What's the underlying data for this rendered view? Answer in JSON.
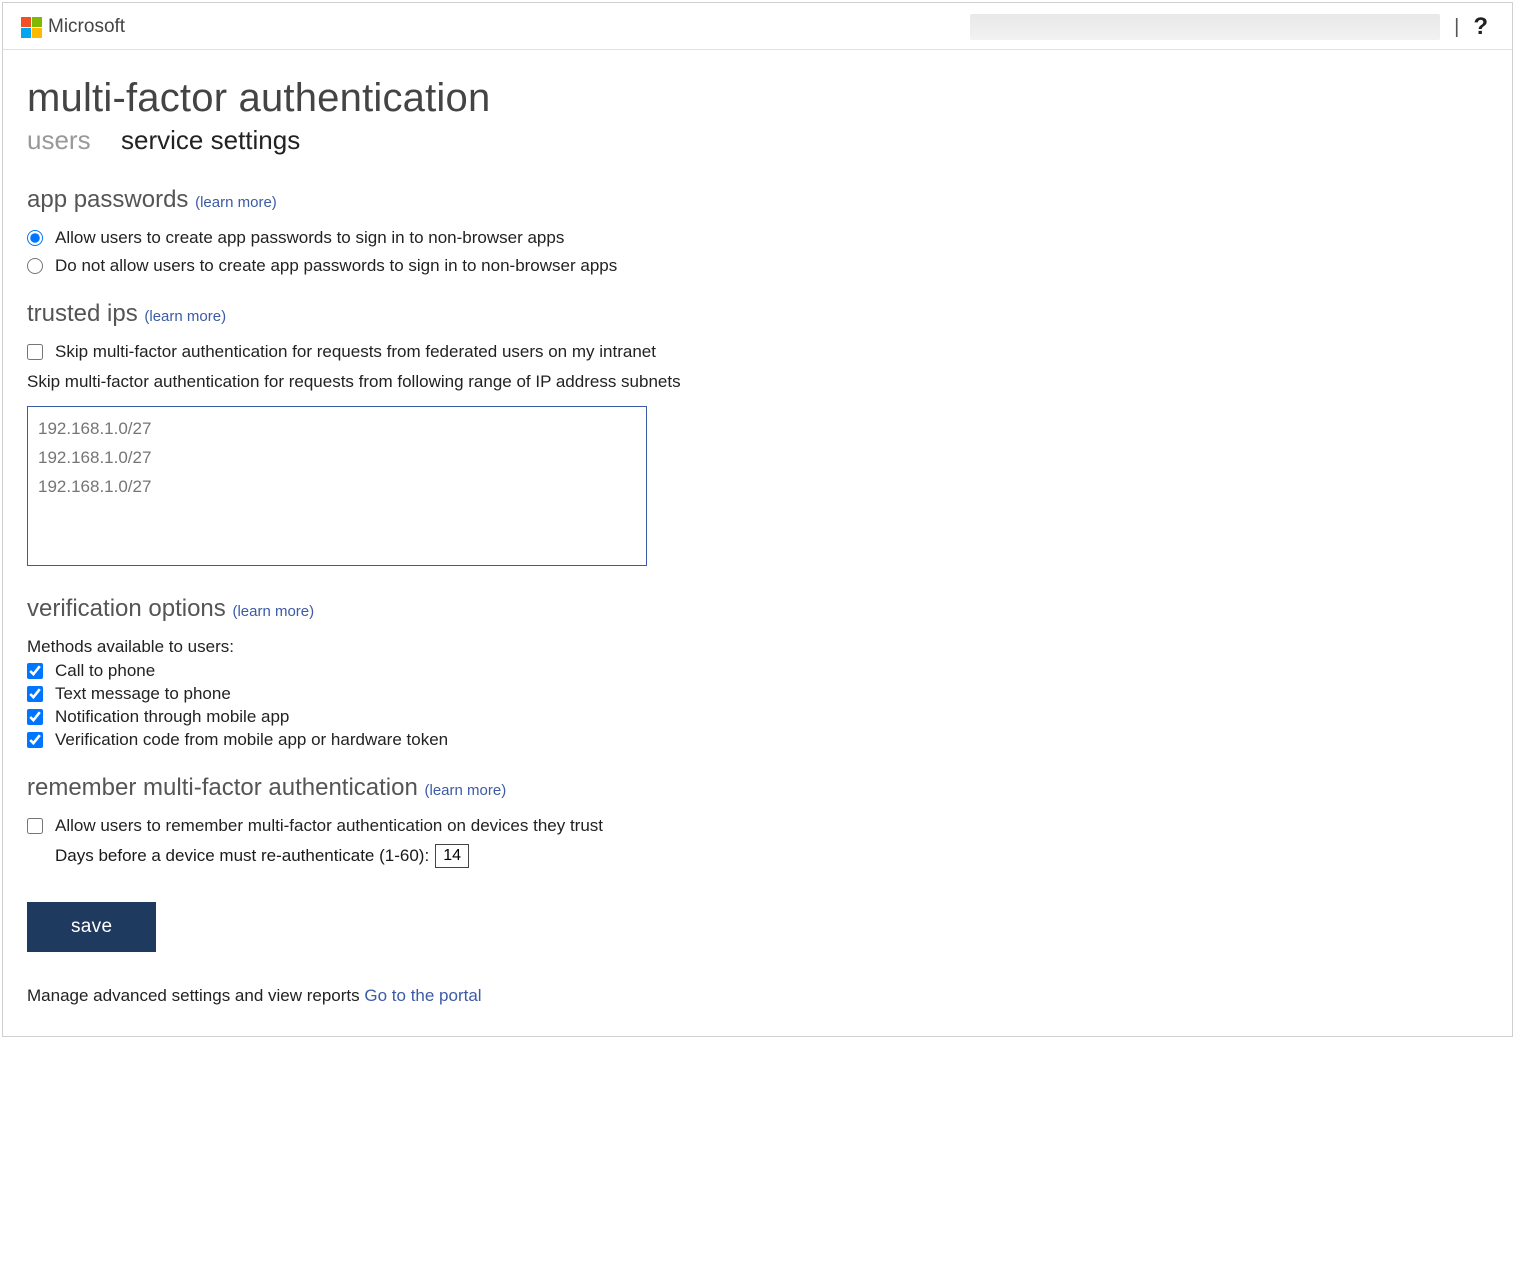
{
  "topbar": {
    "brand": "Microsoft",
    "help_tooltip": "?"
  },
  "page": {
    "title": "multi-factor authentication"
  },
  "tabs": {
    "users": "users",
    "service_settings": "service settings"
  },
  "sections": {
    "app_passwords": {
      "title": "app passwords",
      "learn_more": "(learn more)",
      "option_allow": "Allow users to create app passwords to sign in to non-browser apps",
      "option_deny": "Do not allow users to create app passwords to sign in to non-browser apps",
      "selected": "allow"
    },
    "trusted_ips": {
      "title": "trusted ips",
      "learn_more": "(learn more)",
      "skip_federated_label": "Skip multi-factor authentication for requests from federated users on my intranet",
      "skip_federated_checked": false,
      "range_label": "Skip multi-factor authentication for requests from following range of IP address subnets",
      "textarea_placeholder": "192.168.1.0/27\n192.168.1.0/27\n192.168.1.0/27"
    },
    "verification_options": {
      "title": "verification options",
      "learn_more": "(learn more)",
      "methods_label": "Methods available to users:",
      "methods": [
        {
          "label": "Call to phone",
          "checked": true
        },
        {
          "label": "Text message to phone",
          "checked": true
        },
        {
          "label": "Notification through mobile app",
          "checked": true
        },
        {
          "label": "Verification code from mobile app or hardware token",
          "checked": true
        }
      ]
    },
    "remember_mfa": {
      "title": "remember multi-factor authentication",
      "learn_more": "(learn more)",
      "allow_label": "Allow users to remember multi-factor authentication on devices they trust",
      "allow_checked": false,
      "days_label": "Days before a device must re-authenticate (1-60):",
      "days_value": "14"
    }
  },
  "actions": {
    "save_label": "save"
  },
  "footer": {
    "text": "Manage advanced settings and view reports",
    "link_label": "Go to the portal"
  }
}
